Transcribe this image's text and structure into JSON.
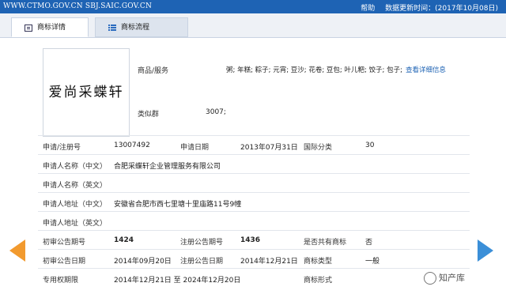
{
  "header": {
    "url_text": "WWW.CTMO.GOV.CN SBJ.SAIC.GOV.CN",
    "help": "帮助",
    "update_label": "数据更新时间：",
    "update_date": "(2017年10月08日)"
  },
  "tabs": [
    {
      "label": "商标详情",
      "icon": "document-icon",
      "active": true
    },
    {
      "label": "商标流程",
      "icon": "list-icon",
      "active": false
    }
  ],
  "trademark": {
    "logo_text": "爱尚采蝶轩",
    "goods_label": "商品/服务",
    "goods_value": "粥; 年糕; 粽子; 元宵; 豆沙; 花卷; 豆包; 叶儿粑; 饺子; 包子;",
    "goods_link": "查看详细信息",
    "similar_group_label": "类似群",
    "similar_group_value": "3007;"
  },
  "rows": {
    "r1": {
      "l1": "申请/注册号",
      "v1": "13007492",
      "l2": "申请日期",
      "v2": "2013年07月31日",
      "l3": "国际分类",
      "v3": "30"
    },
    "r2": {
      "l1": "申请人名称（中文）",
      "v1": "合肥采蝶轩企业管理服务有限公司"
    },
    "r3": {
      "l1": "申请人名称（英文）",
      "v1": ""
    },
    "r4": {
      "l1": "申请人地址（中文）",
      "v1": "安徽省合肥市西七里塘十里庙路11号9幢"
    },
    "r5": {
      "l1": "申请人地址（英文）",
      "v1": ""
    },
    "r6": {
      "l1": "初审公告期号",
      "v1": "1424",
      "l2": "注册公告期号",
      "v2": "1436",
      "l3": "是否共有商标",
      "v3": "否"
    },
    "r7": {
      "l1": "初审公告日期",
      "v1": "2014年09月20日",
      "l2": "注册公告日期",
      "v2": "2014年12月21日",
      "l3": "商标类型",
      "v3": "一般"
    },
    "r8": {
      "l1": "专用权期限",
      "v1": "2014年12月21日 至 2024年12月20日",
      "l3": "商标形式",
      "v3": ""
    }
  },
  "watermark": "知产库",
  "colors": {
    "topbar": "#1e63b4",
    "link": "#1e63b4",
    "arrow_left": "#f29a2e",
    "arrow_right": "#3b8fd8"
  }
}
